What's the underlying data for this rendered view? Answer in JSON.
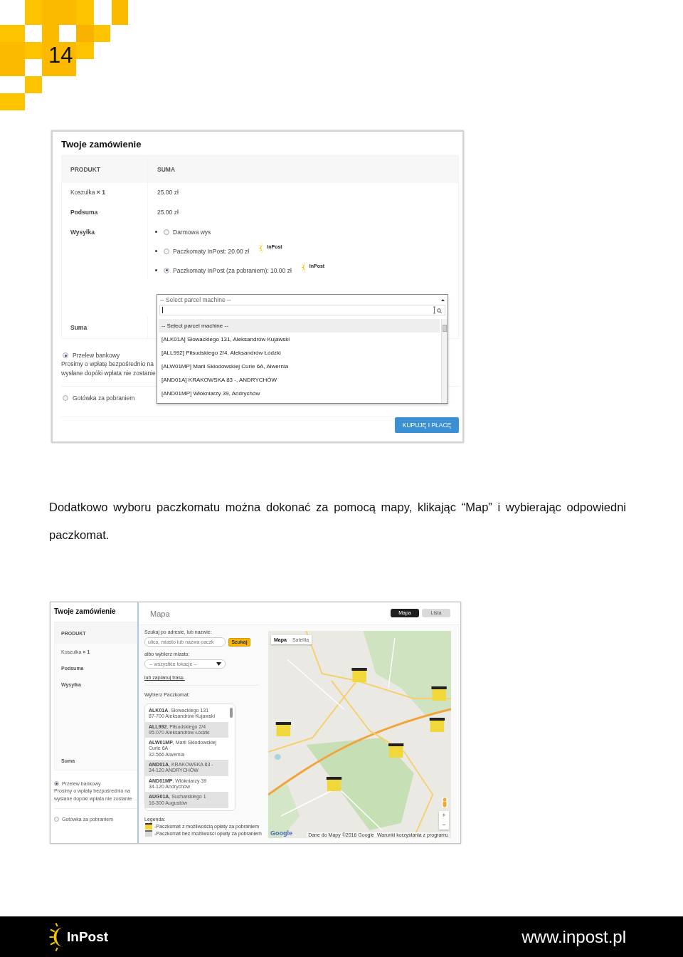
{
  "page_number": "14",
  "checkout": {
    "title": "Twoje zamówienie",
    "columns": [
      "PRODUKT",
      "SUMA"
    ],
    "rows": [
      {
        "label": "Koszulka **× 1**",
        "kind": "item",
        "value": "25.00 zł"
      },
      {
        "label": "Podsuma",
        "kind": "subtotal",
        "value": "25.00 zł"
      }
    ],
    "shipping": {
      "label": "Wysyłka",
      "options": [
        {
          "label": "Darmowa wys",
          "selected": false
        },
        {
          "label": "Paczkomaty InPost: 20.00 zł",
          "selected": false,
          "logo": "InPost"
        },
        {
          "label": "Paczkomaty InPost (za pobraniem): 10.00 zł",
          "selected": true,
          "logo": "InPost"
        }
      ]
    },
    "total_label": "Suma",
    "parcel_select": {
      "value": "-- Select parcel machine --",
      "options": [
        {
          "label": "-- Select parcel machine --",
          "selected": true
        },
        {
          "label": "[ALK01A] Słowackiego 131, Aleksandrów Kujawski",
          "selected": false
        },
        {
          "label": "[ALL992] Piłsudskiego 2/4, Aleksandrów Łódzki",
          "selected": false
        },
        {
          "label": "[ALW01MP] Marii Skłodowskiej Curie 6A, Alwernia",
          "selected": false
        },
        {
          "label": "[AND01A] KRAKOWSKA 83 -, ANDRYCHÓW",
          "selected": false
        },
        {
          "label": "[AND01MP] Włókniarzy 39, Andrychów",
          "selected": false
        }
      ]
    },
    "payment_methods": [
      {
        "label": "Przelew bankowy",
        "selected": true,
        "description": [
          "Prosimy o wpłatę bezpośrednio na",
          "wysłane dopóki wpłata nie zostanie"
        ]
      },
      {
        "label": "Gotówka za pobraniem",
        "selected": false
      }
    ],
    "button": "KUPUJĘ I PŁACĘ"
  },
  "instruction": "Dodatkowo wyboru paczkomatu można dokonać za pomocą mapy, klikając “Map” i wybierając odpowiedni paczkomat.",
  "map_screenshot": {
    "checkout": {
      "title": "Twoje zamówienie",
      "column": "PRODUKT",
      "rows": [
        {
          "label": "Koszulka **× 1**",
          "kind": "item"
        },
        {
          "label": "Podsuma",
          "kind": "subtotal"
        },
        {
          "label": "Wysyłka",
          "kind": "subtotal"
        }
      ],
      "total_label": "Suma",
      "payment_methods": [
        {
          "label": "Przelew bankowy",
          "selected": true,
          "description": [
            "Prosimy o wpłatę bezpośrednio na",
            "wysłane dopóki wpłata nie zostanie"
          ]
        },
        {
          "label": "Gotówka za pobraniem",
          "selected": false
        }
      ]
    },
    "modal": {
      "title": "Mapa",
      "view_tabs": [
        {
          "label": "Mapa",
          "selected": true
        },
        {
          "label": "Lista",
          "selected": false
        }
      ],
      "search_label": "Szukaj po adresie, lub nazwie:",
      "search_placeholder": "ulica, miasto lub nazwa paczk",
      "search_button": "Szukaj",
      "city_label": "albo wybierz miasto:",
      "city_select": "-- wszystkie lokacje --",
      "route_link": "lub zaplanuj trasę.",
      "list_label": "Wybierz Paczkomat:",
      "machines": [
        {
          "lines": [
            "**ALK01A**, Słowackiego 131",
            "87-700 Aleksandrów Kujawski"
          ]
        },
        {
          "lines": [
            "**ALL992**, Piłsudskiego 2/4",
            "95-070 Aleksandrów Łódzki"
          ]
        },
        {
          "lines": [
            "**ALW01MP**, Marii Skłodowskiej",
            "Curie 6A",
            "32-566 Alwernia"
          ]
        },
        {
          "lines": [
            "**AND01A**, KRAKOWSKA 83 -",
            "34-120 ANDRYCHÓW"
          ]
        },
        {
          "lines": [
            "**AND01MP**, Włókniarzy 39",
            "34-120 Andrychów"
          ]
        },
        {
          "lines": [
            "**AUG01A**, Sucharskiego 1",
            "16-300 Augustów"
          ]
        }
      ],
      "legend_title": "Legenda:",
      "legend": [
        {
          "label": "-Paczkomat z możliwością opłaty za pobraniem",
          "kind": "cod"
        },
        {
          "label": "-Paczkomat bez możliwości opłaty za pobraniem",
          "kind": "no_cod"
        }
      ],
      "map": {
        "kind": "picture",
        "type_tabs": [
          {
            "label": "Mapa",
            "selected": true
          },
          {
            "label": "Satelita",
            "selected": false
          }
        ],
        "zoom_controls": [
          "+",
          "−"
        ],
        "logo": "Google",
        "attribution": [
          "Dane do Mapy ©2016 Google",
          "Warunki korzystania z programu"
        ]
      }
    }
  },
  "footer": {
    "logo_text": "InPost",
    "url": "www.inpost.pl"
  }
}
